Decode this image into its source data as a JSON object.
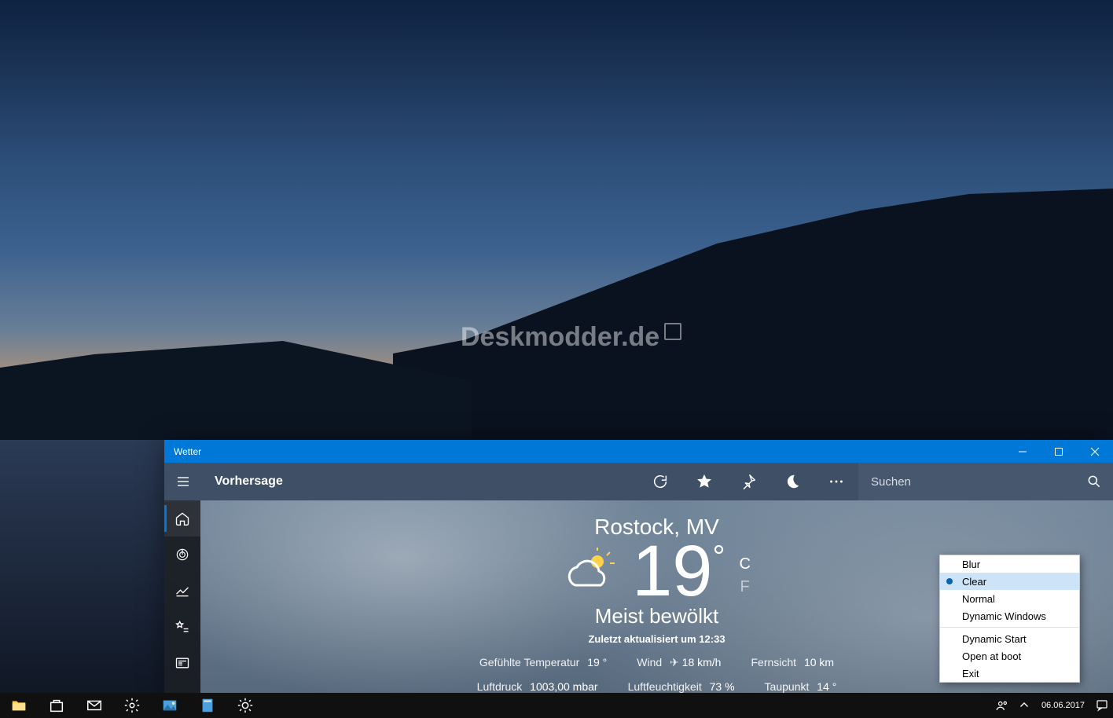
{
  "watermark": "Deskmodder.de",
  "weather": {
    "window_title": "Wetter",
    "page_title": "Vorhersage",
    "search_placeholder": "Suchen",
    "location": "Rostock, MV",
    "temp_value": "19",
    "temp_degree": "°",
    "unit_c": "C",
    "unit_f": "F",
    "condition": "Meist bewölkt",
    "updated": "Zuletzt aktualisiert um 12:33",
    "stats1": {
      "feel_label": "Gefühlte Temperatur",
      "feel_value": "19 °",
      "wind_label": "Wind",
      "wind_value": "18 km/h",
      "vis_label": "Fernsicht",
      "vis_value": "10 km"
    },
    "stats2": {
      "pressure_label": "Luftdruck",
      "pressure_value": "1003,00 mbar",
      "humidity_label": "Luftfeuchtigkeit",
      "humidity_value": "73 %",
      "dew_label": "Taupunkt",
      "dew_value": "14 °"
    }
  },
  "context_menu": {
    "blur": "Blur",
    "clear": "Clear",
    "normal": "Normal",
    "dynamic_windows": "Dynamic Windows",
    "dynamic_start": "Dynamic Start",
    "open_at_boot": "Open at boot",
    "exit": "Exit"
  },
  "taskbar": {
    "date": "06.06.2017"
  }
}
